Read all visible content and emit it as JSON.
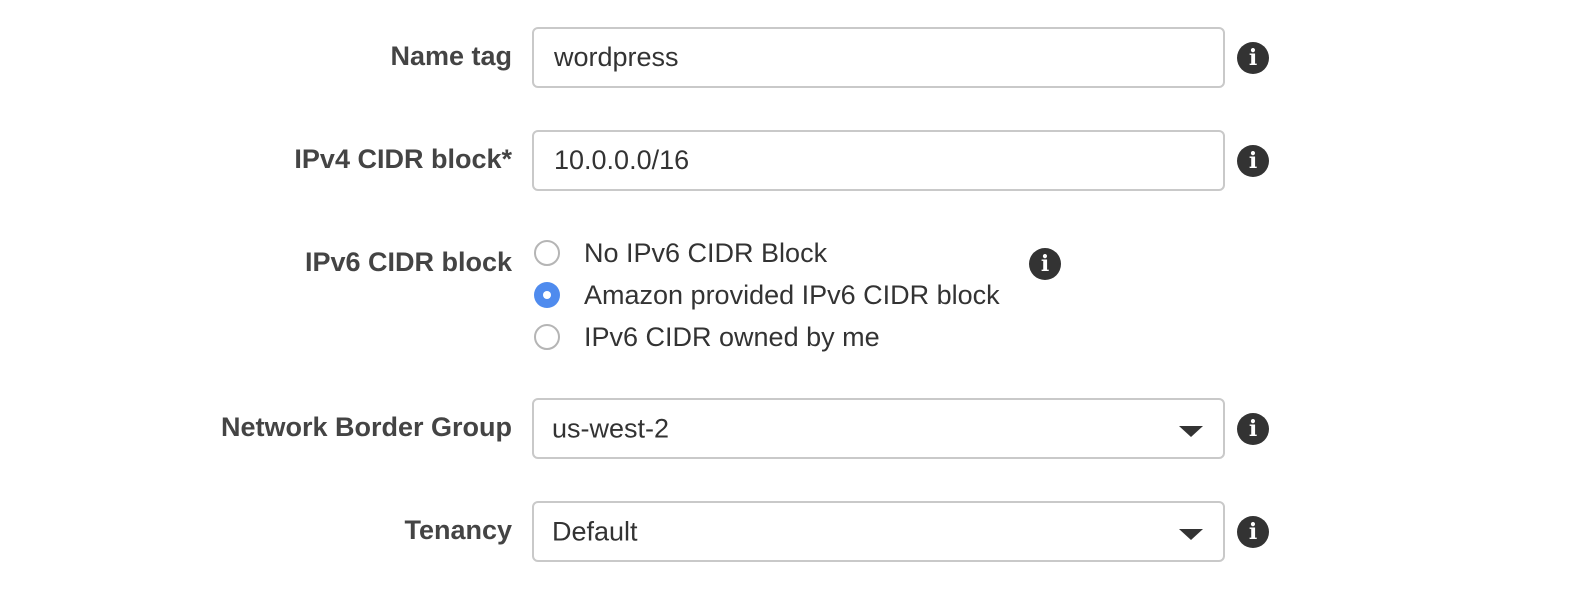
{
  "form": {
    "name_tag": {
      "label": "Name tag",
      "value": "wordpress"
    },
    "ipv4_cidr": {
      "label": "IPv4 CIDR block*",
      "value": "10.0.0.0/16"
    },
    "ipv6_cidr": {
      "label": "IPv6 CIDR block",
      "options": [
        {
          "label": "No IPv6 CIDR Block",
          "selected": false
        },
        {
          "label": "Amazon provided IPv6 CIDR block",
          "selected": true
        },
        {
          "label": "IPv6 CIDR owned by me",
          "selected": false
        }
      ]
    },
    "network_border_group": {
      "label": "Network Border Group",
      "value": "us-west-2"
    },
    "tenancy": {
      "label": "Tenancy",
      "value": "Default"
    }
  },
  "icons": {
    "info": "info-icon",
    "info_glyph": "i",
    "dropdown": "caret-down-icon"
  },
  "colors": {
    "radio_selected": "#4f8bee",
    "label_text": "#444444",
    "input_border": "#c9c9c9",
    "icon_fill": "#333333"
  }
}
